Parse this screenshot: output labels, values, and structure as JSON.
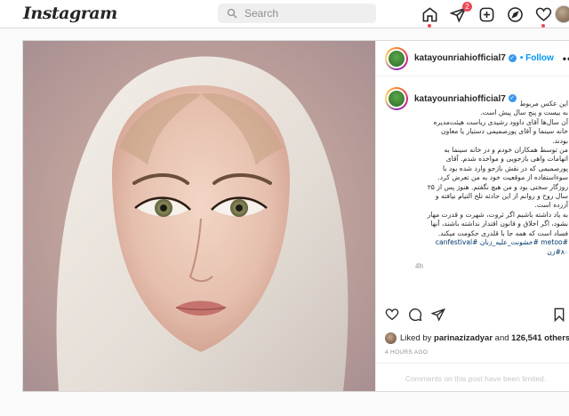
{
  "header": {
    "logo": "Instagram",
    "search_placeholder": "Search",
    "notification_count": "2"
  },
  "post": {
    "username": "katayounriahiofficial7",
    "verified_mark": "✓",
    "follow_separator": "•",
    "follow_label": "Follow",
    "more_label": "•••",
    "caption_lines": [
      "این عکس مربوط",
      "به بیست و پنج سال پیش است.",
      "آن سال‌ها آقای داوود رشیدی ریاست هیئت‌مدیره",
      "خانه سینما و آقای پورصمیمی دستیار یا معاون",
      "بودند.",
      "من توسط همکاران خودم و در خانه سینما به",
      "اتهامات واهی بازجویی و مواخذه شدم. آقای",
      "پورصمیمی که در نقش بازجو وارد شده بود با",
      "سوءاستفاده از موقعیت خود به من تعرض کرد.",
      "روزگار سختی بود و من هیچ نگفتم. هنوز پس از ۲۵",
      "سال روح و روانم از این حادثه تلخ التیام نیافته و",
      "آزرده است.",
      "به یاد داشته باشیم اگر ثروت، شهرت و قدرت مهار",
      "نشود، اگر اخلاق و قانون اقتدار نداشته باشند، آنها",
      "فساد است که همه جا با قلدری حکومت میکند."
    ],
    "hashtags_line1": "#metoo #خشونت_علیه_زنان #canfestival",
    "hashtags_line2": "#۸۰زن",
    "time_short": "4h",
    "likes_prefix": "Liked by",
    "likes_user": "parinazizadyar",
    "likes_and": "and",
    "likes_count": "126,541 others",
    "time_ago": "4 HOURS AGO",
    "comments_limited": "Comments on this post have been limited."
  },
  "colors": {
    "accent": "#0095f6",
    "badge": "#ed4956",
    "hashtag": "#00376b"
  }
}
